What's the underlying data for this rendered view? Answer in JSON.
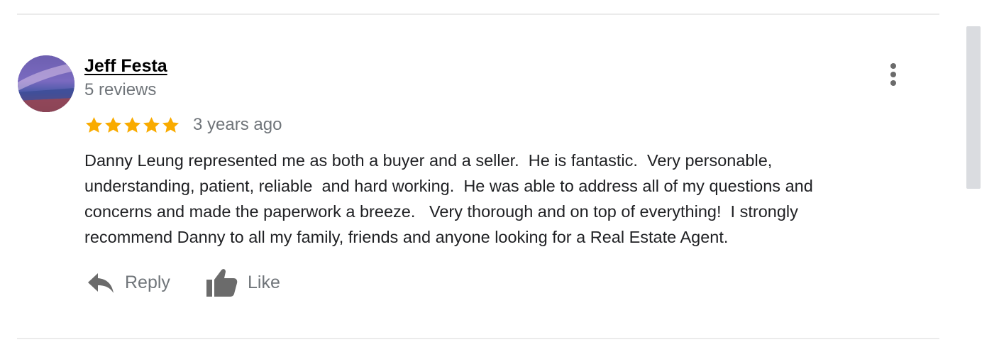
{
  "review": {
    "reviewer_name": "Jeff Festa",
    "review_count": "5 reviews",
    "rating": 5,
    "rating_max": 5,
    "time_ago": "3 years ago",
    "text": "Danny Leung represented me as both a buyer and a seller.  He is fantastic.  Very personable,\nunderstanding, patient, reliable  and hard working.  He was able to address all of my questions and\nconcerns and made the paperwork a breeze.   Very thorough and on top of everything!  I strongly\nrecommend Danny to all my family, friends and anyone looking for a Real Estate Agent.",
    "avatar_icon": "profile-photo"
  },
  "actions": {
    "reply_label": "Reply",
    "reply_icon": "reply-arrow-icon",
    "like_label": "Like",
    "like_icon": "thumbs-up-icon",
    "more_icon": "more-vertical-icon"
  },
  "colors": {
    "star": "#f9ab00",
    "secondary_text": "#70757a",
    "body_text": "#202124",
    "icon": "#6b6b6b"
  }
}
